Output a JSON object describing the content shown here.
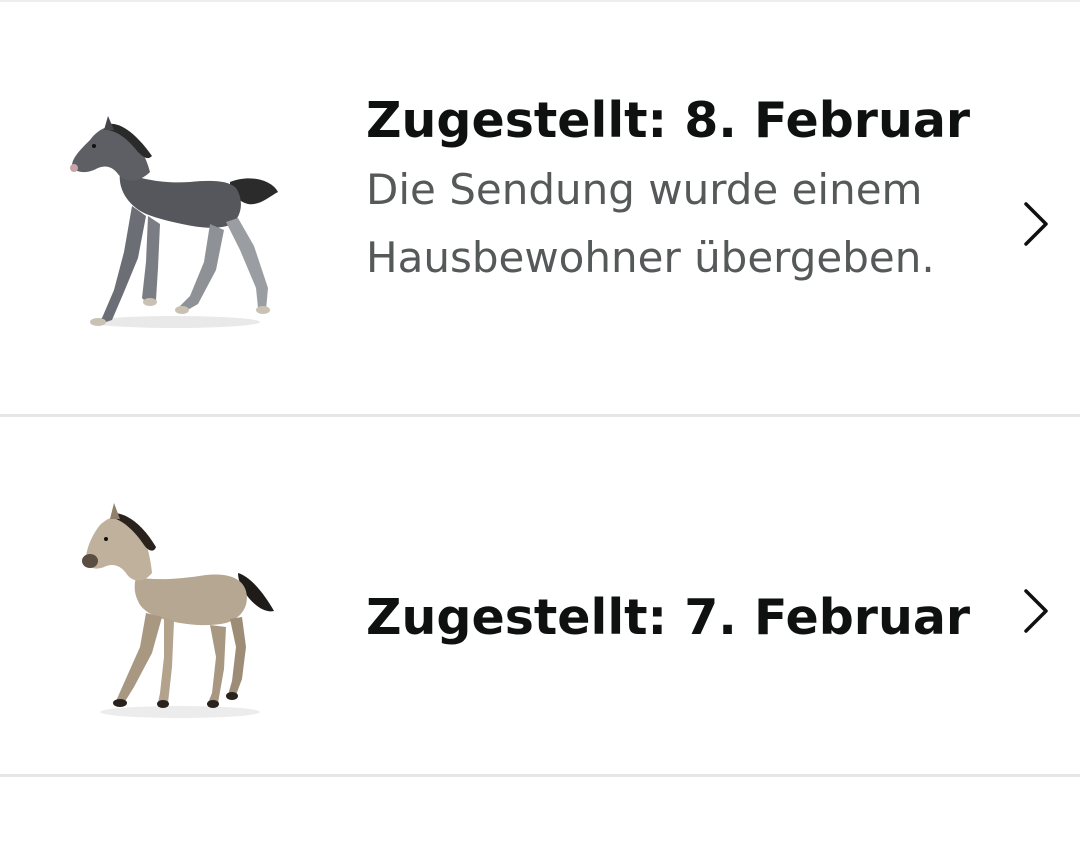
{
  "orders": [
    {
      "title": "Zugestellt: 8. Februar",
      "description": "Die Sendung wurde einem Hausbewohner übergeben.",
      "image": "grey-foal-toy-figure",
      "chevron": "chevron-right-icon"
    },
    {
      "title": "Zugestellt: 7. Februar",
      "description": "",
      "image": "beige-foal-toy-figure",
      "chevron": "chevron-right-icon"
    }
  ],
  "colors": {
    "title": "#0f1111",
    "description": "#565959",
    "divider": "#e6e6e6",
    "background": "#ffffff"
  }
}
